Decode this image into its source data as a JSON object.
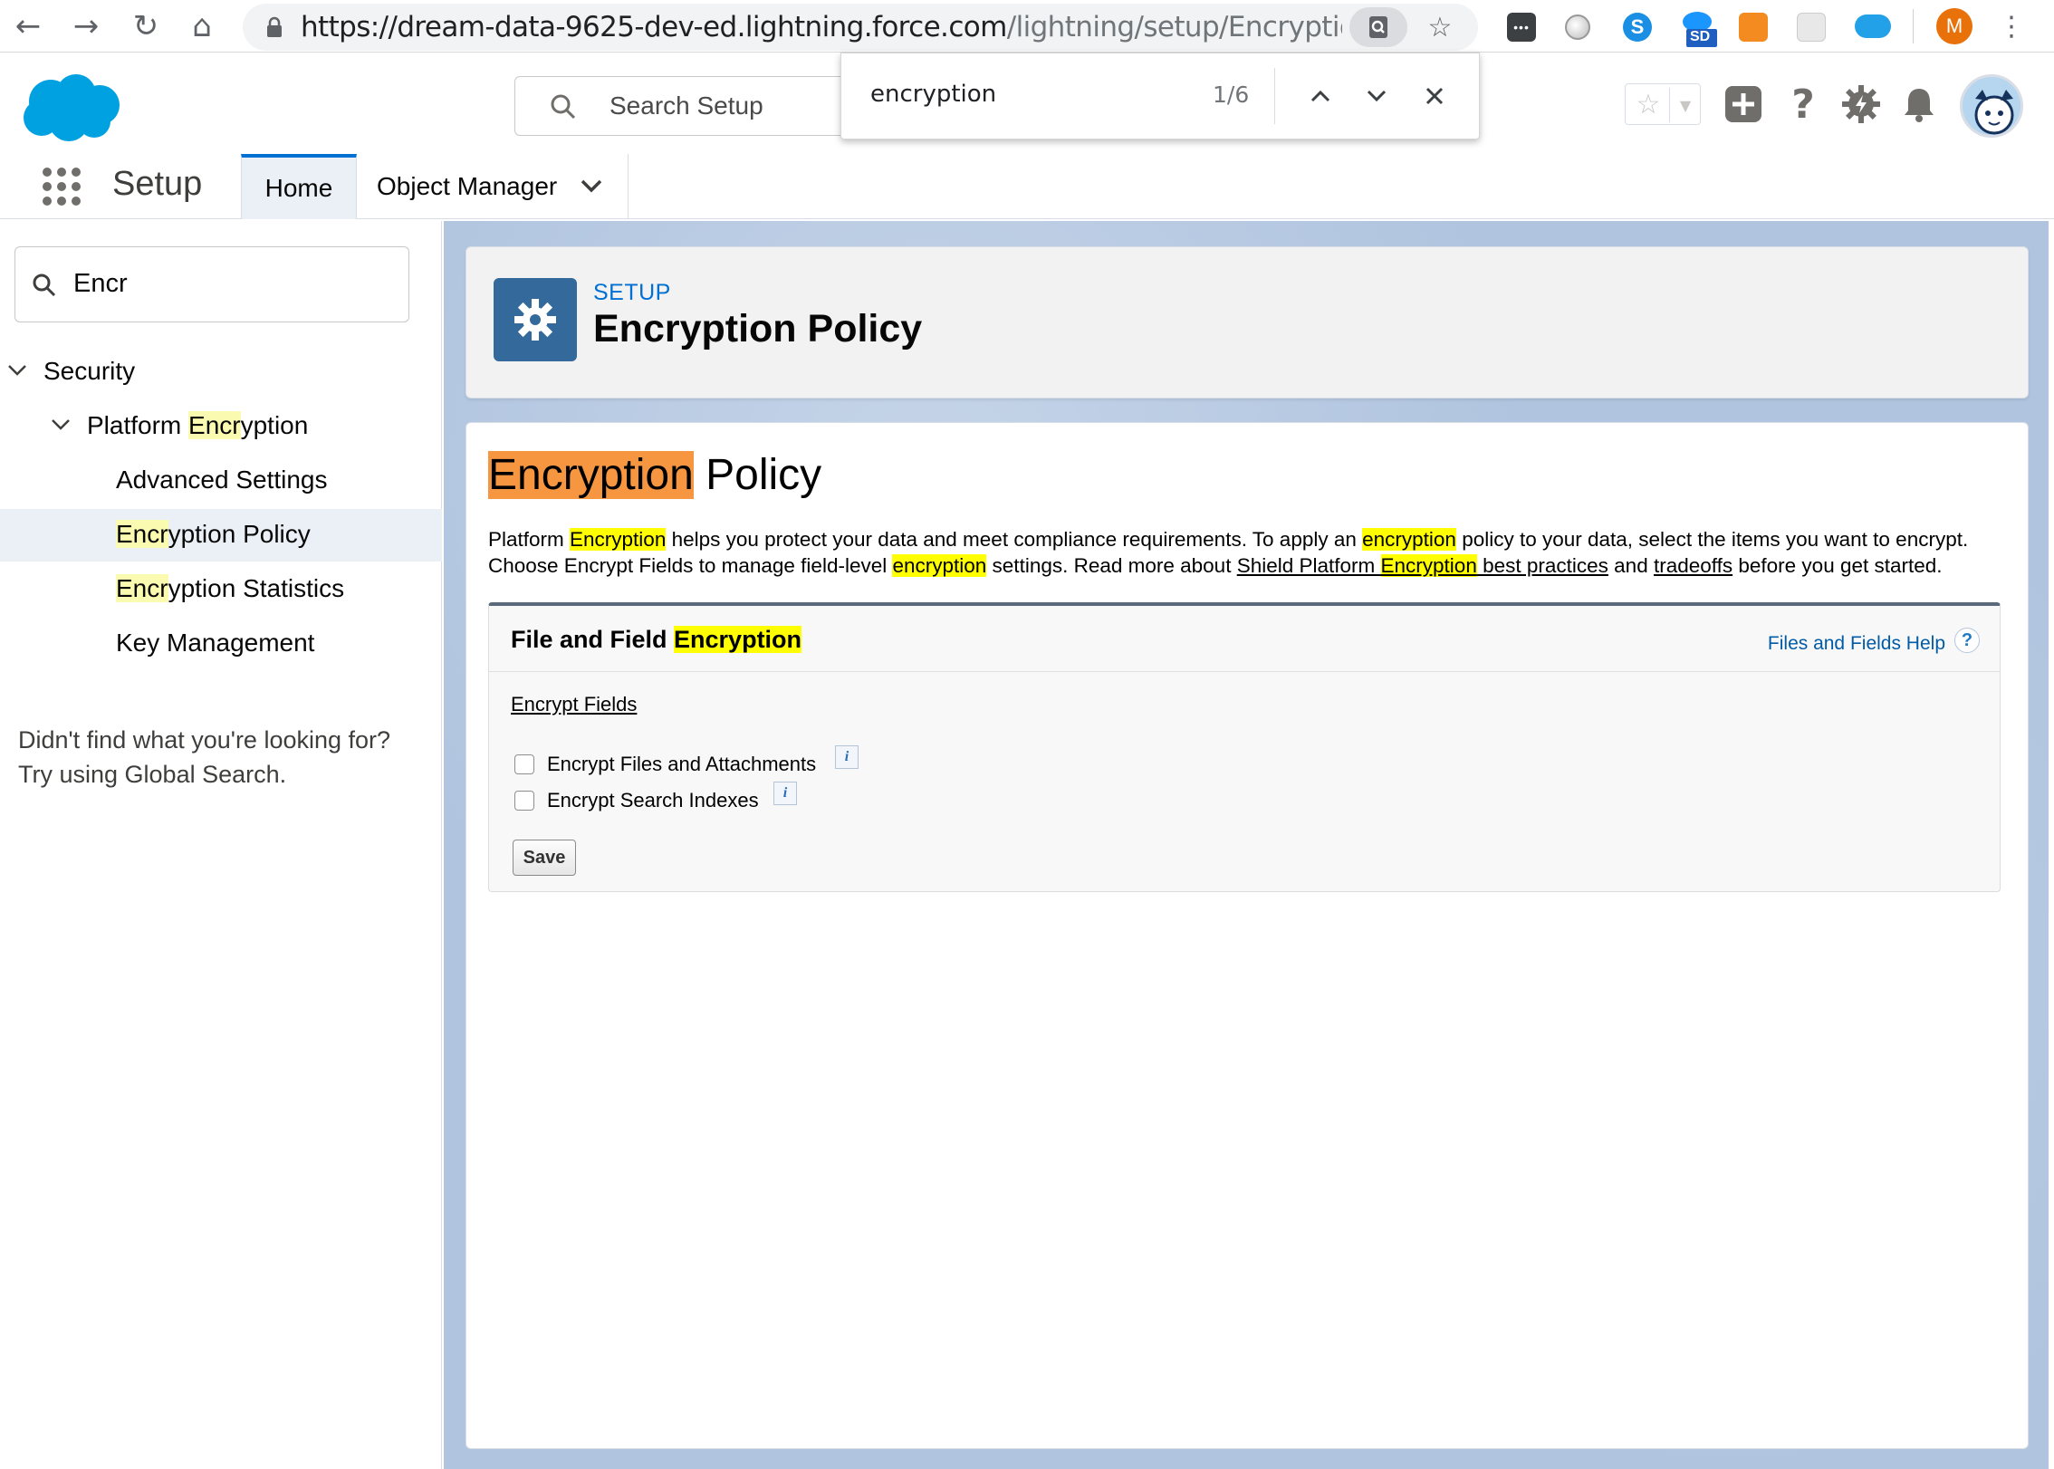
{
  "browser": {
    "url_host": "https://dream-data-9625-dev-ed.lightning.force.com",
    "url_path": "/lightning/setup/EncryptionPolicy...",
    "profile_initial": "M",
    "extension_badge": "SD"
  },
  "find_bar": {
    "query": "encryption",
    "count": "1/6"
  },
  "header": {
    "search_placeholder": "Search Setup"
  },
  "context_bar": {
    "app_name": "Setup",
    "tabs": [
      {
        "label": "Home"
      },
      {
        "label": "Object Manager"
      }
    ]
  },
  "left_nav": {
    "quick_find_value": "Encr",
    "tree": [
      {
        "label": "Security"
      },
      {
        "label_pre": "Platform ",
        "label_hl": "Encr",
        "label_post": "yption"
      },
      {
        "label": "Advanced Settings"
      },
      {
        "label_hl": "Encr",
        "label_post": "yption Policy"
      },
      {
        "label_hl": "Encr",
        "label_post": "yption Statistics"
      },
      {
        "label": "Key Management"
      }
    ],
    "not_found_line1": "Didn't find what you're looking for?",
    "not_found_line2": "Try using Global Search."
  },
  "page_header": {
    "eyebrow": "SETUP",
    "title": "Encryption Policy"
  },
  "content": {
    "title_hl": "Encryption",
    "title_rest": " Policy",
    "desc": {
      "p1": "Platform ",
      "h1": "Encryption",
      "p2": " helps you protect your data and meet compliance requirements. To apply an ",
      "h2": "encryption",
      "p3": " policy to your data, select the items you want to encrypt. Choose Encrypt Fields to manage field-level ",
      "h3": "encryption",
      "p4": " settings. Read more about ",
      "link1_pre": "Shield Platform ",
      "link1_hl": "Encryption",
      "link1_post": " best practices",
      "p5": " and ",
      "link2": "tradeoffs",
      "p6": " before you get started."
    },
    "section": {
      "title_pre": "File and Field ",
      "title_hl": "Encryption",
      "help_label": "Files and Fields Help",
      "help_icon": "?",
      "encrypt_fields_link": "Encrypt Fields",
      "options": [
        {
          "label": "Encrypt Files and Attachments",
          "checked": false
        },
        {
          "label": "Encrypt Search Indexes",
          "checked": false
        }
      ],
      "info_glyph": "i",
      "save_label": "Save"
    }
  }
}
